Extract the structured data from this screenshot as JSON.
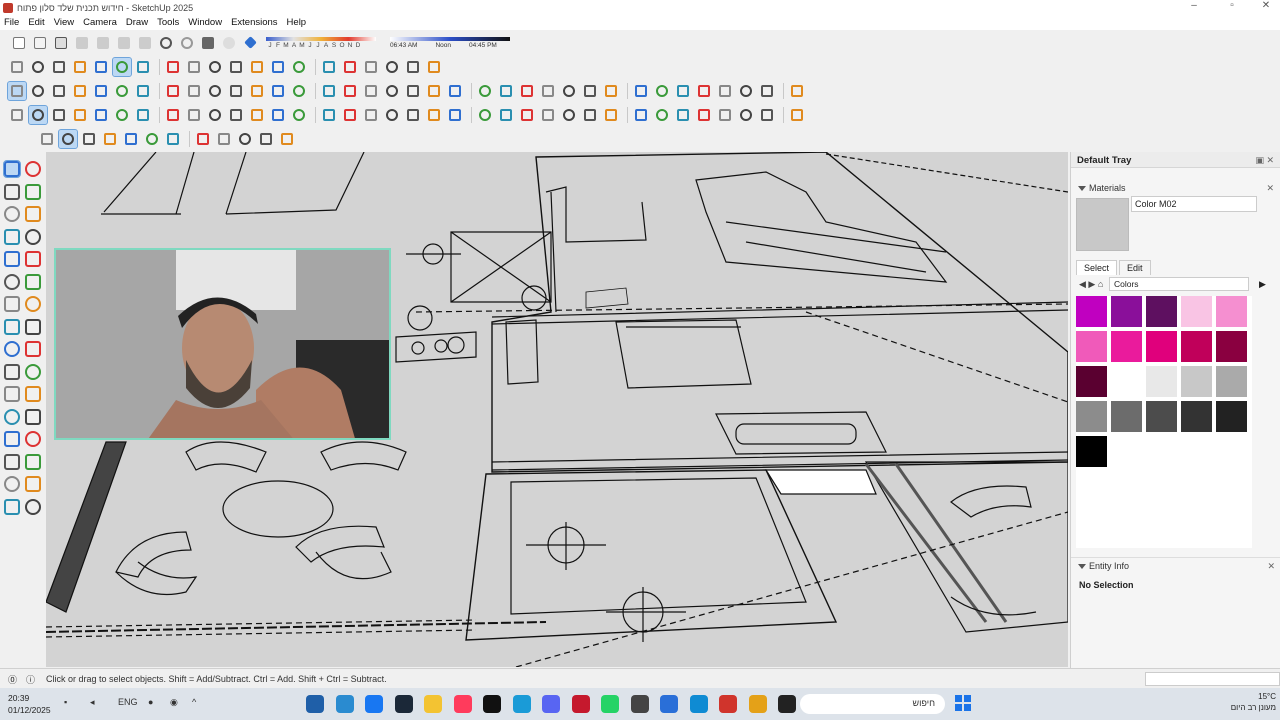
{
  "window": {
    "title": "חידוש תכנית שלד סלון פתוח - SketchUp 2025"
  },
  "menu": [
    "File",
    "Edit",
    "View",
    "Camera",
    "Draw",
    "Tools",
    "Window",
    "Extensions",
    "Help"
  ],
  "shadow_settings": {
    "months": [
      "J",
      "F",
      "M",
      "A",
      "M",
      "J",
      "J",
      "A",
      "S",
      "O",
      "N",
      "D"
    ],
    "time_start": "06:43 AM",
    "time_mid": "Noon",
    "time_end": "04:45 PM"
  },
  "tray": {
    "title": "Default Tray",
    "materials_header": "Materials",
    "material_name": "Color M02",
    "tab_select": "Select",
    "tab_edit": "Edit",
    "collection": "Colors",
    "swatches": [
      "#c000c0",
      "#8a0f9a",
      "#5e1060",
      "#f9c4e4",
      "#f58fd0",
      "#f05aba",
      "#ea1b9c",
      "#e0007c",
      "#c0005a",
      "#8a0040",
      "#5a0030",
      "#ffffff",
      "#e8e8e8",
      "#c8c8c8",
      "#aaaaaa",
      "#8c8c8c",
      "#6c6c6c",
      "#4c4c4c",
      "#333333",
      "#222222",
      "#000000"
    ],
    "entity_header": "Entity Info",
    "entity_status": "No Selection"
  },
  "status": {
    "hint": "Click or drag to select objects. Shift = Add/Subtract. Ctrl = Add. Shift + Ctrl = Subtract."
  },
  "taskbar": {
    "time": "20:39",
    "date": "01/12/2025",
    "lang": "ENG",
    "search_placeholder": "חיפוש",
    "temperature": "15°C",
    "weather": "מעונן רב היום"
  }
}
